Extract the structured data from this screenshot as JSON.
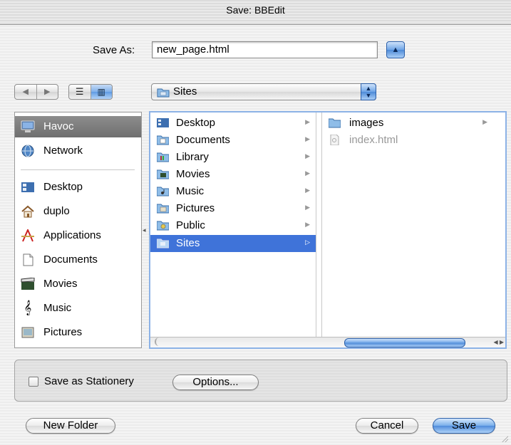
{
  "window": {
    "title": "Save: BBEdit"
  },
  "save_as": {
    "label": "Save As:",
    "value": "new_page.html"
  },
  "location": {
    "current": "Sites"
  },
  "sidebar": {
    "items": [
      {
        "label": "Havoc",
        "icon": "computer-icon",
        "selected": true
      },
      {
        "label": "Network",
        "icon": "network-globe-icon"
      },
      {
        "label": "Desktop",
        "icon": "desktop-folder-icon"
      },
      {
        "label": "duplo",
        "icon": "home-icon"
      },
      {
        "label": "Applications",
        "icon": "applications-icon"
      },
      {
        "label": "Documents",
        "icon": "documents-icon"
      },
      {
        "label": "Movies",
        "icon": "movies-clapper-icon"
      },
      {
        "label": "Music",
        "icon": "music-note-icon"
      },
      {
        "label": "Pictures",
        "icon": "pictures-icon"
      }
    ]
  },
  "columns": {
    "col1": [
      {
        "label": "Desktop",
        "icon": "desktop-folder-icon"
      },
      {
        "label": "Documents",
        "icon": "documents-folder-icon"
      },
      {
        "label": "Library",
        "icon": "library-folder-icon"
      },
      {
        "label": "Movies",
        "icon": "movies-folder-icon"
      },
      {
        "label": "Music",
        "icon": "music-folder-icon"
      },
      {
        "label": "Pictures",
        "icon": "pictures-folder-icon"
      },
      {
        "label": "Public",
        "icon": "public-folder-icon"
      },
      {
        "label": "Sites",
        "icon": "sites-folder-icon",
        "selected": true
      }
    ],
    "col2": [
      {
        "label": "images",
        "icon": "folder-icon"
      },
      {
        "label": "index.html",
        "icon": "html-file-icon",
        "disabled": true
      }
    ]
  },
  "options": {
    "stationery_label": "Save as Stationery",
    "stationery_checked": false,
    "options_button": "Options..."
  },
  "buttons": {
    "new_folder": "New Folder",
    "cancel": "Cancel",
    "save": "Save"
  },
  "colors": {
    "selection_blue": "#3f73d9",
    "sidebar_selection": "#7a7a7a",
    "aqua_blue": "#5f9be3"
  }
}
